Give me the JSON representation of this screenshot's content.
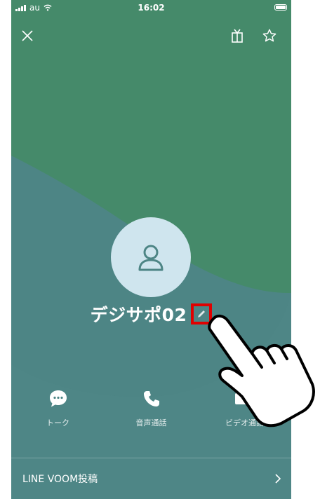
{
  "status_bar": {
    "carrier": "au",
    "time": "16:02"
  },
  "header": {
    "close_icon": "close-icon",
    "gift_icon": "gift-icon",
    "favorite_icon": "star-icon"
  },
  "profile": {
    "name": "デジサポ02",
    "edit_icon": "pencil-icon",
    "avatar_icon": "person-icon"
  },
  "actions": [
    {
      "label": "トーク",
      "icon": "chat-bubble-icon"
    },
    {
      "label": "音声通話",
      "icon": "phone-icon"
    },
    {
      "label": "ビデオ通話",
      "icon": "video-camera-icon"
    }
  ],
  "voom": {
    "label": "LINE VOOM投稿"
  },
  "colors": {
    "bg_teal": "#4d8585",
    "bg_green": "#458a6a",
    "avatar": "#cfe5ee",
    "highlight": "#e10000"
  }
}
